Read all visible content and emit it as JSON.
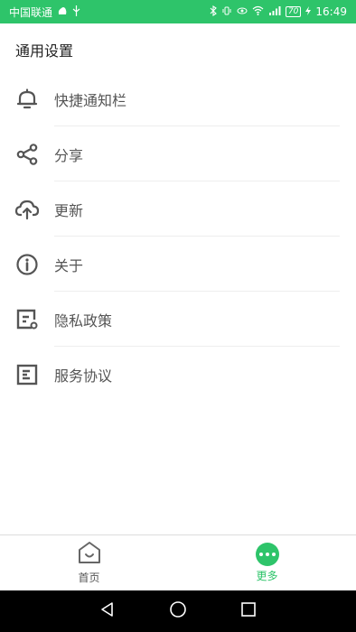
{
  "status_bar": {
    "carrier": "中国联通",
    "battery": "70",
    "time": "16:49"
  },
  "section_title": "通用设置",
  "menu": [
    {
      "label": "快捷通知栏",
      "icon": "bell-icon"
    },
    {
      "label": "分享",
      "icon": "share-icon"
    },
    {
      "label": "更新",
      "icon": "cloud-upload-icon"
    },
    {
      "label": "关于",
      "icon": "info-icon"
    },
    {
      "label": "隐私政策",
      "icon": "privacy-doc-icon"
    },
    {
      "label": "服务协议",
      "icon": "agreement-doc-icon"
    }
  ],
  "bottom_nav": {
    "home_label": "首页",
    "more_label": "更多"
  },
  "colors": {
    "accent": "#2ec46a"
  }
}
